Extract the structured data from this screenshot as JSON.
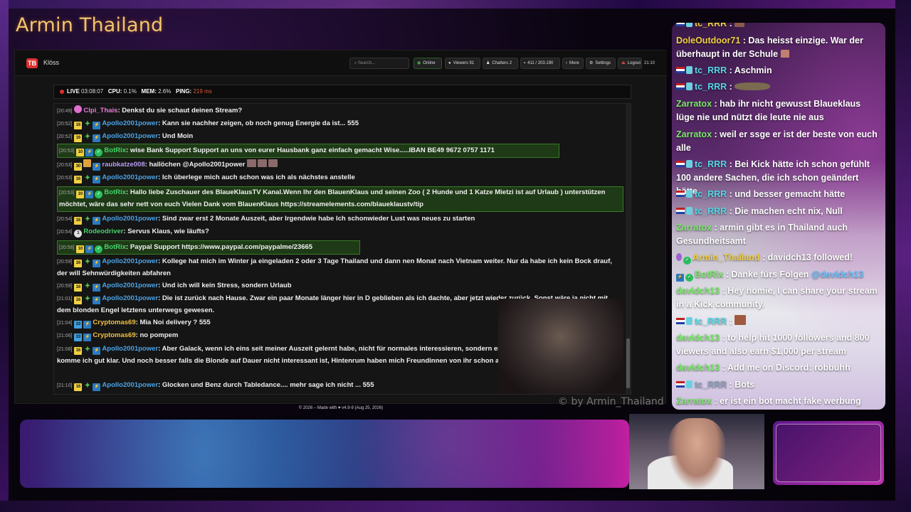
{
  "streamer": {
    "title": "Armin Thailand",
    "watermark": "© by Armin_Thailand"
  },
  "app": {
    "logo_text": "TB",
    "name": "Klöss",
    "search_placeholder": "Search...",
    "online_label": "Online",
    "viewers_label": "Viewers",
    "viewers_count": "91",
    "chatters_label": "Chatters",
    "chatters_count": "2",
    "messages_label": "411 / 203.190",
    "more_label": "More",
    "settings_label": "Settings",
    "logout_label": "Logout",
    "clock": "21:10",
    "footer": "© 2026 – Made with ♥ v4.9-9 (Aug 25, 2026)"
  },
  "status": {
    "live_label": "LIVE",
    "live_time": "03:08:07",
    "cpu_label": "CPU:",
    "cpu_value": "0.1%",
    "mem_label": "MEM:",
    "mem_value": "2.6%",
    "ping_label": "PING:",
    "ping_value": "219 ms"
  },
  "chat": [
    {
      "ts": "[20:49]",
      "user": "Clpi_Thais",
      "text": "Denkst du sie schaut deinen Stream?"
    },
    {
      "ts": "[20:52]",
      "badge": "16",
      "user": "Apollo2001power",
      "text": "Kann sie nachher zeigen, ob noch genug Energie da ist... 555"
    },
    {
      "ts": "[20:52]",
      "badge": "16",
      "user": "Apollo2001power",
      "text": "Und Moin"
    },
    {
      "ts": "[20:53]",
      "badge": "10",
      "user": "BotRix",
      "text": "wise Bank Support Support an uns von eurer Hausbank ganz einfach gemacht Wise.....IBAN BE49 9672 0757 1171"
    },
    {
      "ts": "[20:53]",
      "badge": "30",
      "user": "raubkatze008",
      "text": "hallöchen @Apollo2001power"
    },
    {
      "ts": "[20:53]",
      "badge": "16",
      "user": "Apollo2001power",
      "text": "Ich überlege mich auch schon was ich als nächstes anstelle"
    },
    {
      "ts": "[20:53]",
      "badge": "10",
      "user": "BotRix",
      "text": "Hallo liebe Zuschauer des BlaueKlausTV Kanal.Wenn Ihr den BlauenKlaus und seinen Zoo ( 2 Hunde und 1 Katze Mietzi ist auf Urlaub ) unterstützen möchtet, wäre das sehr nett von euch Vielen Dank vom BlauenKlaus https://streamelements.com/blaueklaustv/tip"
    },
    {
      "ts": "[20:54]",
      "badge": "16",
      "user": "Apollo2001power",
      "text": "Sind zwar erst 2 Monate Auszeit, aber Irgendwie habe Ich schonwieder Lust was neues zu starten"
    },
    {
      "ts": "[20:54]",
      "badge": "1",
      "user": "Rodeodriver",
      "text": "Servus Klaus, wie läufts?"
    },
    {
      "ts": "[20:58]",
      "badge": "10",
      "user": "BotRix",
      "text": "Paypal Support https://www.paypal.com/paypalme/23665"
    },
    {
      "ts": "[20:59]",
      "badge": "16",
      "user": "Apollo2001power",
      "text": "Kollege hat mich im Winter ja eingeladen 2 oder 3 Tage Thailand und dann nen Monat nach Vietnam weiter. Nur da habe ich kein Bock drauf, der will Sehnwürdigkeiten abfahren"
    },
    {
      "ts": "[20:59]",
      "badge": "16",
      "user": "Apollo2001power",
      "text": "Und ich will kein Stress, sondern Urlaub"
    },
    {
      "ts": "[21:01]",
      "badge": "16",
      "user": "Apollo2001power",
      "text": "Die ist zurück nach Hause. Zwar ein paar Monate länger hier in D geblieben als ich dachte, aber jetzt wieder zurück. Sonst wäre ja nicht mit dem blonden Engel letztens unterwegs gewesen."
    },
    {
      "ts": "[21:04]",
      "badge": "33",
      "user": "Cryptomas69",
      "text": "Mia Noi delivery ? 555"
    },
    {
      "ts": "[21:06]",
      "badge": "33",
      "user": "Cryptomas69",
      "text": "no pompem"
    },
    {
      "ts": "[21:08]",
      "badge": "16",
      "user": "Apollo2001power",
      "text": "Aber Galack, wenn ich eins seit meiner Auszeit gelernt habe, nicht für normales interessieren, sondern eiskalt ab an die Modeltypen. Mit denen komme ich gut klar. Und noch besser falls die Blonde auf Dauer nicht interessant ist, Hintenrum haben mich Freundinnen von ihr schon angebaggert"
    },
    {
      "ts": "[21:10]",
      "badge": "16",
      "user": "Apollo2001power",
      "text": "Glocken und Benz durch Tabledance.... mehr sage ich nicht ... 555"
    }
  ],
  "side_chat": [
    {
      "user": "tc_RRR",
      "text": ":"
    },
    {
      "user": "DoleOutdoor71",
      "text": ": Das heisst einzige. War der überhaupt in der Schule"
    },
    {
      "user": "tc_RRR",
      "text": ": Aschmin"
    },
    {
      "user": "tc_RRR",
      "text": ":"
    },
    {
      "user": "Zarratox",
      "text": ": hab ihr nicht gewusst Blaueklaus lüge nie und nützt die leute nie aus"
    },
    {
      "user": "Zarratox",
      "text": ": weil er ssge er ist der beste von euch alle"
    },
    {
      "user": "tc_RRR",
      "text": ": Bei Kick hätte ich schon gefühlt 100 andere Sachen, die ich schon geändert hätte."
    },
    {
      "user": "tc_RRR",
      "text": ": und besser gemacht hätte"
    },
    {
      "user": "tc_RRR",
      "text": ": Die machen echt nix, Null"
    },
    {
      "user": "Zarratox",
      "text": ": armin gibt es in Thailand auch Gesundheitsamt"
    },
    {
      "user": "Armin_Thailand",
      "text": ": davidch13 followed!"
    },
    {
      "user": "BotRix",
      "text": ": Danke fürs Folgen",
      "mention": "@davidch13"
    },
    {
      "user": "davidch13",
      "text": ": Hey homie, I can share your stream in a Kick community."
    },
    {
      "user": "tc_RRR",
      "text": ":"
    },
    {
      "user": "davidch13",
      "text": ": to help hit 1000 followers and 800 viewers and also earn $1,000 per stream"
    },
    {
      "user": "davidch13",
      "text": ": Add me on Discord: robbuhh"
    },
    {
      "user": "tc_RRR",
      "text": ": Bots"
    },
    {
      "user": "Zarratox",
      "text": ": er ist ein bot macht fake werbung"
    }
  ],
  "colors": {
    "brand": "#e03030",
    "bot_bg": "#1e3a16",
    "bot_border": "#3a7a2a",
    "username_blue": "#4aa3e6",
    "title": "#f2c46a"
  }
}
